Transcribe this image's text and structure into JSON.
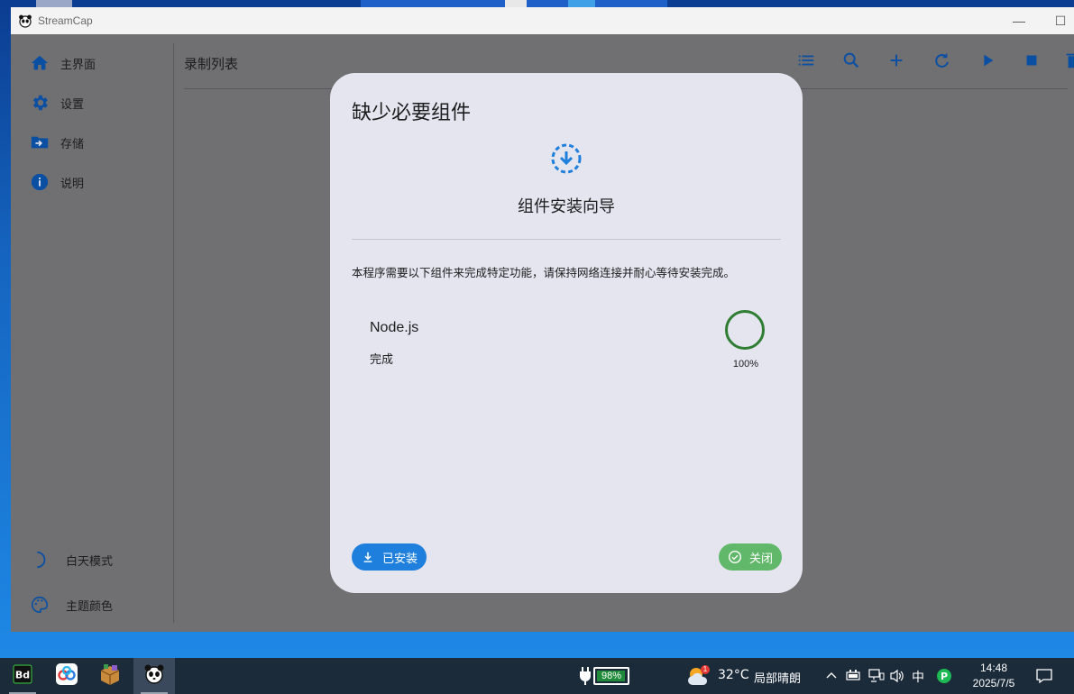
{
  "window": {
    "title": "StreamCap",
    "minimize_glyph": "—",
    "maximize_glyph": "☐"
  },
  "sidebar": {
    "items": [
      {
        "label": "主界面",
        "icon": "home-icon"
      },
      {
        "label": "设置",
        "icon": "gear-icon"
      },
      {
        "label": "存储",
        "icon": "folder-icon"
      },
      {
        "label": "说明",
        "icon": "info-icon"
      }
    ],
    "bottom": [
      {
        "label": "白天模式",
        "icon": "moon-icon"
      },
      {
        "label": "主题颜色",
        "icon": "palette-icon"
      }
    ]
  },
  "main": {
    "title": "录制列表",
    "toolbar": [
      "list-icon",
      "search-icon",
      "plus-icon",
      "refresh-icon",
      "play-icon",
      "stop-icon",
      "delete-icon"
    ]
  },
  "dialog": {
    "title": "缺少必要组件",
    "subtitle": "组件安装向导",
    "description": "本程序需要以下组件来完成特定功能，请保持网络连接并耐心等待安装完成。",
    "component": {
      "name": "Node.js",
      "status": "完成",
      "progress_text": "100%",
      "progress": 1.0
    },
    "install_button": "已安装",
    "close_button": "关闭"
  },
  "taskbar": {
    "apps": [
      "bd-app-icon",
      "baidu-netdisk-icon",
      "package-box-icon",
      "streamcap-panda-icon"
    ],
    "battery": "98%",
    "battery_level": 0.98,
    "weather_temp": "32°C",
    "weather_desc": "局部晴朗",
    "weather_badge": "1",
    "ime": "中",
    "time": "14:48",
    "date": "2025/7/5"
  },
  "colors": {
    "accent": "#1e7fdc",
    "success": "#2e7d32",
    "close_button": "#62b86a",
    "overlay": "#707072",
    "dialog_bg": "#e4e5ee"
  }
}
